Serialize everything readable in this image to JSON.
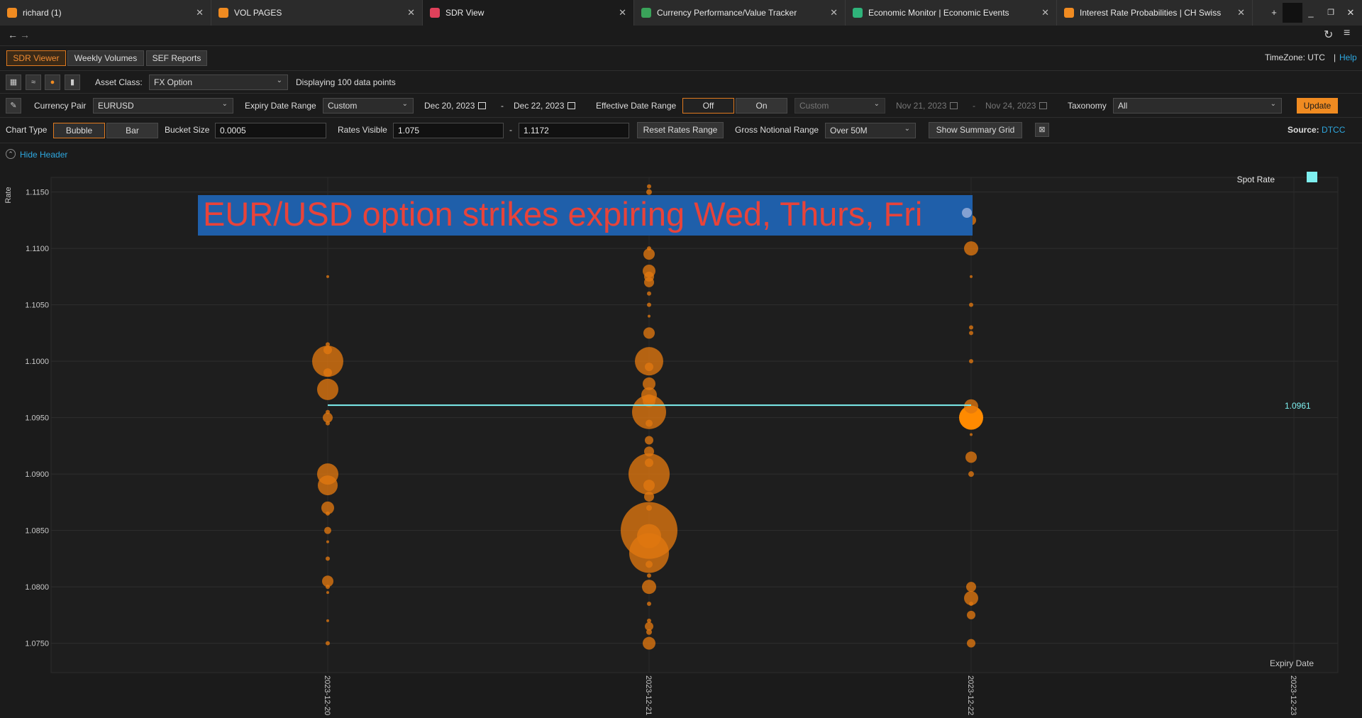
{
  "tabs": [
    {
      "label": "richard (1)",
      "color": "#f08b21"
    },
    {
      "label": "VOL PAGES",
      "color": "#f08b21"
    },
    {
      "label": "SDR View",
      "color": "#e0415b"
    },
    {
      "label": "Currency Performance/Value Tracker",
      "color": "#3aa35a"
    },
    {
      "label": "Economic Monitor | Economic Events",
      "color": "#2fb37a"
    },
    {
      "label": "Interest Rate Probabilities | CH Swiss National B",
      "color": "#f08b21"
    }
  ],
  "nav": {
    "back": "←",
    "forward": "→"
  },
  "toolbar": {
    "tabs": [
      "SDR Viewer",
      "Weekly Volumes",
      "SEF Reports"
    ],
    "timezone": "TimeZone: UTC",
    "separator": "|",
    "help": "Help"
  },
  "filters": {
    "asset_class_label": "Asset Class:",
    "asset_class": "FX Option",
    "displaying": "Displaying 100 data points",
    "currency_pair_label": "Currency Pair",
    "currency_pair": "EURUSD",
    "expiry_range_label": "Expiry Date Range",
    "expiry_range": "Custom",
    "expiry_from": "Dec 20, 2023",
    "expiry_to": "Dec 22, 2023",
    "dash": "-",
    "effective_range_label": "Effective Date Range",
    "toggle_off": "Off",
    "toggle_on": "On",
    "effective_range": "Custom",
    "effective_from": "Nov 21, 2023",
    "effective_to": "Nov 24, 2023",
    "taxonomy_label": "Taxonomy",
    "taxonomy": "All",
    "update": "Update"
  },
  "chart_controls": {
    "chart_type_label": "Chart Type",
    "bubble": "Bubble",
    "bar": "Bar",
    "bucket_label": "Bucket Size",
    "bucket": "0.0005",
    "rates_label": "Rates Visible",
    "rate_from": "1.075",
    "rate_to": "1.1172",
    "reset": "Reset Rates Range",
    "gross_label": "Gross Notional Range",
    "gross": "Over 50M",
    "summary": "Show Summary Grid",
    "source_label": "Source:",
    "source": "DTCC"
  },
  "header_toggle": "Hide Header",
  "colors": {
    "bubble": "#e07710",
    "highlight": "#ff8a00",
    "spot": "#7ef0f0",
    "banner": "#1f5faa",
    "banner_text": "#e8433a"
  },
  "chart_data": {
    "type": "scatter",
    "ylabel": "Rate",
    "xlabel": "Expiry Date",
    "annotation": "EUR/USD option strikes expiring Wed, Thurs, Fri",
    "legend": "Spot Rate",
    "spot_rate": 1.0961,
    "spot_label": "1.0961",
    "ylim": [
      1.0724,
      1.1163
    ],
    "yticks": [
      1.075,
      1.08,
      1.085,
      1.09,
      1.095,
      1.1,
      1.105,
      1.11,
      1.115
    ],
    "ytick_labels": [
      "1.0750",
      "1.0800",
      "1.0850",
      "1.0900",
      "1.0950",
      "1.1000",
      "1.1050",
      "1.1100",
      "1.1150"
    ],
    "x_labels": [
      "2023-12-20",
      "2023-12-21",
      "2023-12-22",
      "2023-12-23"
    ],
    "points": [
      {
        "x": "2023-12-20",
        "y": 1.1075,
        "r": 2
      },
      {
        "x": "2023-12-20",
        "y": 1.1015,
        "r": 3
      },
      {
        "x": "2023-12-20",
        "y": 1.101,
        "r": 6
      },
      {
        "x": "2023-12-20",
        "y": 1.1,
        "r": 22
      },
      {
        "x": "2023-12-20",
        "y": 1.099,
        "r": 6
      },
      {
        "x": "2023-12-20",
        "y": 1.0975,
        "r": 15
      },
      {
        "x": "2023-12-20",
        "y": 1.0955,
        "r": 3
      },
      {
        "x": "2023-12-20",
        "y": 1.095,
        "r": 7
      },
      {
        "x": "2023-12-20",
        "y": 1.0945,
        "r": 3
      },
      {
        "x": "2023-12-20",
        "y": 1.09,
        "r": 15
      },
      {
        "x": "2023-12-20",
        "y": 1.089,
        "r": 14
      },
      {
        "x": "2023-12-20",
        "y": 1.087,
        "r": 9
      },
      {
        "x": "2023-12-20",
        "y": 1.0865,
        "r": 3
      },
      {
        "x": "2023-12-20",
        "y": 1.085,
        "r": 5
      },
      {
        "x": "2023-12-20",
        "y": 1.084,
        "r": 2
      },
      {
        "x": "2023-12-20",
        "y": 1.0825,
        "r": 3
      },
      {
        "x": "2023-12-20",
        "y": 1.0805,
        "r": 8
      },
      {
        "x": "2023-12-20",
        "y": 1.08,
        "r": 3
      },
      {
        "x": "2023-12-20",
        "y": 1.0795,
        "r": 2
      },
      {
        "x": "2023-12-20",
        "y": 1.077,
        "r": 2
      },
      {
        "x": "2023-12-20",
        "y": 1.075,
        "r": 3
      },
      {
        "x": "2023-12-21",
        "y": 1.1155,
        "r": 3
      },
      {
        "x": "2023-12-21",
        "y": 1.115,
        "r": 4
      },
      {
        "x": "2023-12-21",
        "y": 1.1145,
        "r": 3
      },
      {
        "x": "2023-12-21",
        "y": 1.11,
        "r": 3
      },
      {
        "x": "2023-12-21",
        "y": 1.1095,
        "r": 8
      },
      {
        "x": "2023-12-21",
        "y": 1.108,
        "r": 9
      },
      {
        "x": "2023-12-21",
        "y": 1.1075,
        "r": 7
      },
      {
        "x": "2023-12-21",
        "y": 1.107,
        "r": 7
      },
      {
        "x": "2023-12-21",
        "y": 1.106,
        "r": 3
      },
      {
        "x": "2023-12-21",
        "y": 1.105,
        "r": 3
      },
      {
        "x": "2023-12-21",
        "y": 1.104,
        "r": 2
      },
      {
        "x": "2023-12-21",
        "y": 1.1025,
        "r": 8
      },
      {
        "x": "2023-12-21",
        "y": 1.1,
        "r": 20
      },
      {
        "x": "2023-12-21",
        "y": 1.0995,
        "r": 6
      },
      {
        "x": "2023-12-21",
        "y": 1.098,
        "r": 9
      },
      {
        "x": "2023-12-21",
        "y": 1.097,
        "r": 11
      },
      {
        "x": "2023-12-21",
        "y": 1.0965,
        "r": 9
      },
      {
        "x": "2023-12-21",
        "y": 1.0955,
        "r": 24
      },
      {
        "x": "2023-12-21",
        "y": 1.0945,
        "r": 5
      },
      {
        "x": "2023-12-21",
        "y": 1.093,
        "r": 6
      },
      {
        "x": "2023-12-21",
        "y": 1.092,
        "r": 7
      },
      {
        "x": "2023-12-21",
        "y": 1.091,
        "r": 6
      },
      {
        "x": "2023-12-21",
        "y": 1.09,
        "r": 29
      },
      {
        "x": "2023-12-21",
        "y": 1.089,
        "r": 8
      },
      {
        "x": "2023-12-21",
        "y": 1.088,
        "r": 7
      },
      {
        "x": "2023-12-21",
        "y": 1.087,
        "r": 4
      },
      {
        "x": "2023-12-21",
        "y": 1.085,
        "r": 40
      },
      {
        "x": "2023-12-21",
        "y": 1.0845,
        "r": 17
      },
      {
        "x": "2023-12-21",
        "y": 1.083,
        "r": 28
      },
      {
        "x": "2023-12-21",
        "y": 1.082,
        "r": 5
      },
      {
        "x": "2023-12-21",
        "y": 1.081,
        "r": 3
      },
      {
        "x": "2023-12-21",
        "y": 1.08,
        "r": 10
      },
      {
        "x": "2023-12-21",
        "y": 1.0785,
        "r": 3
      },
      {
        "x": "2023-12-21",
        "y": 1.077,
        "r": 3
      },
      {
        "x": "2023-12-21",
        "y": 1.0765,
        "r": 6
      },
      {
        "x": "2023-12-21",
        "y": 1.076,
        "r": 4
      },
      {
        "x": "2023-12-21",
        "y": 1.075,
        "r": 9
      },
      {
        "x": "2023-12-22",
        "y": 1.1125,
        "r": 7
      },
      {
        "x": "2023-12-22",
        "y": 1.11,
        "r": 10
      },
      {
        "x": "2023-12-22",
        "y": 1.1075,
        "r": 2
      },
      {
        "x": "2023-12-22",
        "y": 1.105,
        "r": 3
      },
      {
        "x": "2023-12-22",
        "y": 1.103,
        "r": 3
      },
      {
        "x": "2023-12-22",
        "y": 1.1025,
        "r": 3
      },
      {
        "x": "2023-12-22",
        "y": 1.1,
        "r": 3
      },
      {
        "x": "2023-12-22",
        "y": 1.096,
        "r": 10
      },
      {
        "x": "2023-12-22",
        "y": 1.095,
        "r": 17
      },
      {
        "x": "2023-12-22",
        "y": 1.0935,
        "r": 2
      },
      {
        "x": "2023-12-22",
        "y": 1.0915,
        "r": 8
      },
      {
        "x": "2023-12-22",
        "y": 1.09,
        "r": 4
      },
      {
        "x": "2023-12-22",
        "y": 1.08,
        "r": 7
      },
      {
        "x": "2023-12-22",
        "y": 1.079,
        "r": 10
      },
      {
        "x": "2023-12-22",
        "y": 1.0785,
        "r": 3
      },
      {
        "x": "2023-12-22",
        "y": 1.0775,
        "r": 6
      },
      {
        "x": "2023-12-22",
        "y": 1.075,
        "r": 6
      }
    ]
  }
}
